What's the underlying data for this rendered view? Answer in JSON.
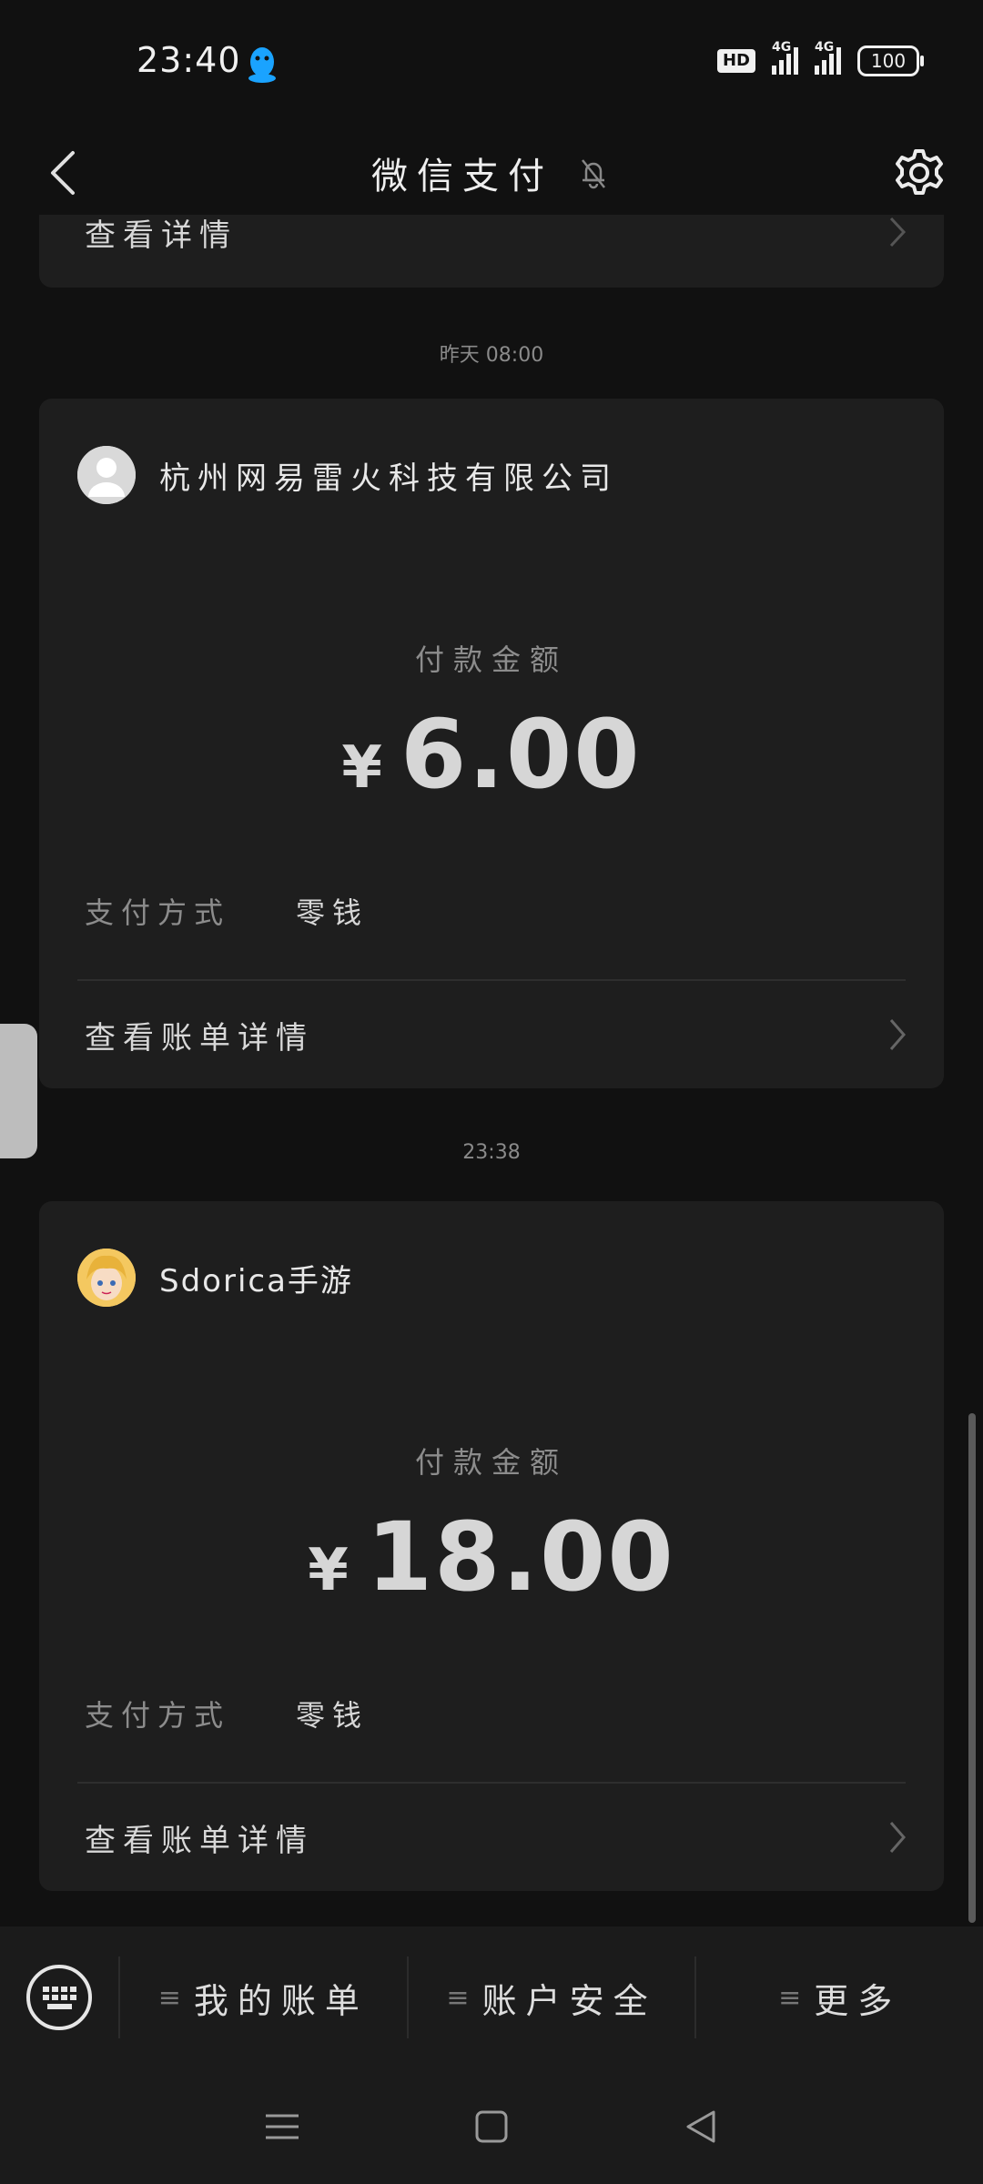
{
  "status_bar": {
    "time": "23:40",
    "hd_badge": "HD",
    "signal1_label": "4G",
    "signal2_label": "4G",
    "battery": "100"
  },
  "header": {
    "title": "微信支付"
  },
  "prev_card": {
    "detail_label": "查看详情"
  },
  "timestamps": [
    "昨天 08:00",
    "23:38"
  ],
  "transactions": [
    {
      "merchant": "杭州网易雷火科技有限公司",
      "amount_label": "付款金额",
      "currency": "¥",
      "amount": "6.00",
      "method_key": "支付方式",
      "method_value": "零钱",
      "detail_label": "查看账单详情"
    },
    {
      "merchant": "Sdorica手游",
      "amount_label": "付款金额",
      "currency": "¥",
      "amount": "18.00",
      "method_key": "支付方式",
      "method_value": "零钱",
      "detail_label": "查看账单详情"
    }
  ],
  "bottom_menu": {
    "items": [
      "我的账单",
      "账户安全",
      "更多"
    ]
  },
  "icons": {
    "back": "chevron-left-icon",
    "mute": "bell-off-icon",
    "settings": "gear-icon",
    "keyboard": "keyboard-icon",
    "menu": "hamburger-icon",
    "nav_recents": "menu-icon",
    "nav_home": "square-icon",
    "nav_back": "triangle-back-icon"
  }
}
